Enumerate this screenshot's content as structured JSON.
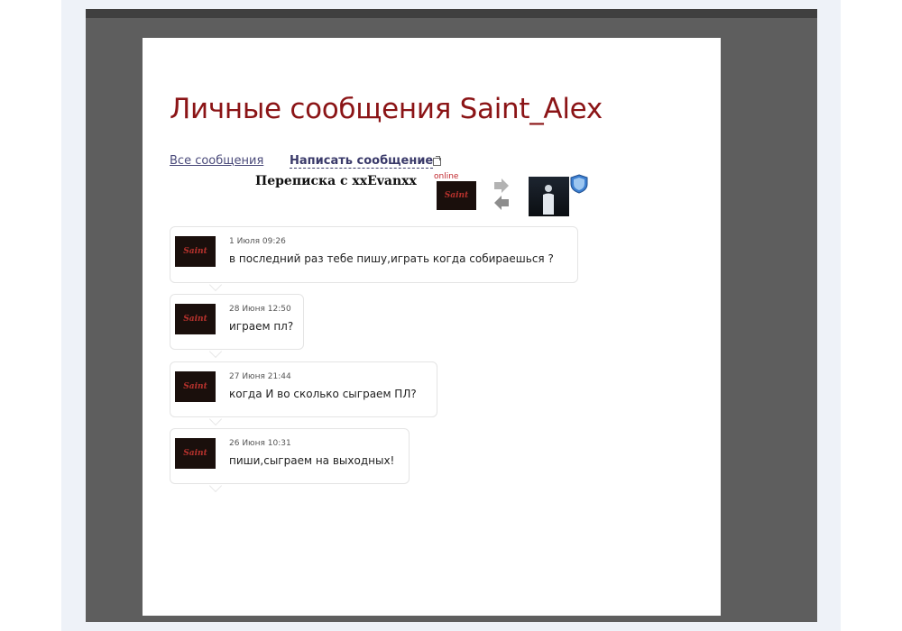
{
  "page": {
    "title": "Личные сообщения Saint_Alex"
  },
  "nav": {
    "all_messages": "Все сообщения",
    "write_message": "Написать сообщение"
  },
  "conversation": {
    "title": "Переписка с xxEvanxx",
    "status": "online",
    "avatar_logo": "Saint"
  },
  "messages": [
    {
      "timestamp": "1 Июля 09:26",
      "text": "в последний раз тебе пишу,играть когда собираешься ?",
      "avatar_logo": "Saint"
    },
    {
      "timestamp": "28 Июня 12:50",
      "text": "играем пл?",
      "avatar_logo": "Saint"
    },
    {
      "timestamp": "27 Июня 21:44",
      "text": "когда И во сколько сыграем ПЛ?",
      "avatar_logo": "Saint"
    },
    {
      "timestamp": "26 Июня 10:31",
      "text": "пиши,сыграем на выходных!",
      "avatar_logo": "Saint"
    }
  ],
  "colors": {
    "title": "#8b1416",
    "link": "#4a4a7a",
    "online": "#c0262c",
    "frame": "#5e5e5e",
    "page_bg": "#eef2f8"
  },
  "icons": {
    "external_link": "external-link-icon",
    "arrow_right": "arrow-right-icon",
    "arrow_left": "arrow-left-icon",
    "badge": "shield-badge-icon"
  }
}
